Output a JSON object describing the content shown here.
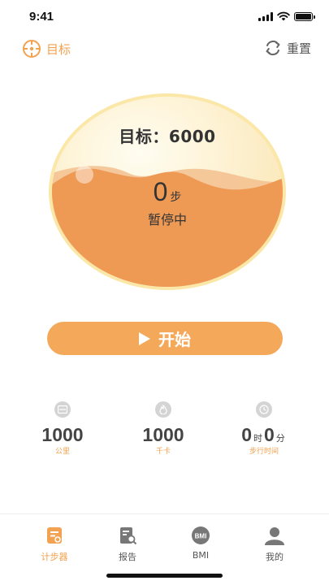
{
  "status_bar": {
    "time": "9:41"
  },
  "top_bar": {
    "goal_label": "目标",
    "reset_label": "重置"
  },
  "circle": {
    "goal_text": "目标：6000",
    "steps_value": "0",
    "steps_unit": "步",
    "state_text": "暂停中"
  },
  "start_button": {
    "label": "开始"
  },
  "stats": [
    {
      "icon": "distance-icon",
      "value": "1000",
      "label": "公里"
    },
    {
      "icon": "calorie-icon",
      "value": "1000",
      "label": "千卡"
    },
    {
      "icon": "clock-icon",
      "hours": "0",
      "hours_unit": "时",
      "minutes": "0",
      "minutes_unit": "分",
      "label": "步行时间"
    }
  ],
  "tabs": [
    {
      "label": "计步器",
      "icon": "pedometer-icon",
      "active": true
    },
    {
      "label": "报告",
      "icon": "report-icon",
      "active": false
    },
    {
      "label": "BMI",
      "icon": "bmi-icon",
      "active": false
    },
    {
      "label": "我的",
      "icon": "profile-icon",
      "active": false
    }
  ],
  "colors": {
    "accent": "#f4a85a",
    "wave": "#ee9a55",
    "ring": "#fbe3a4",
    "label": "#f0a04d"
  }
}
